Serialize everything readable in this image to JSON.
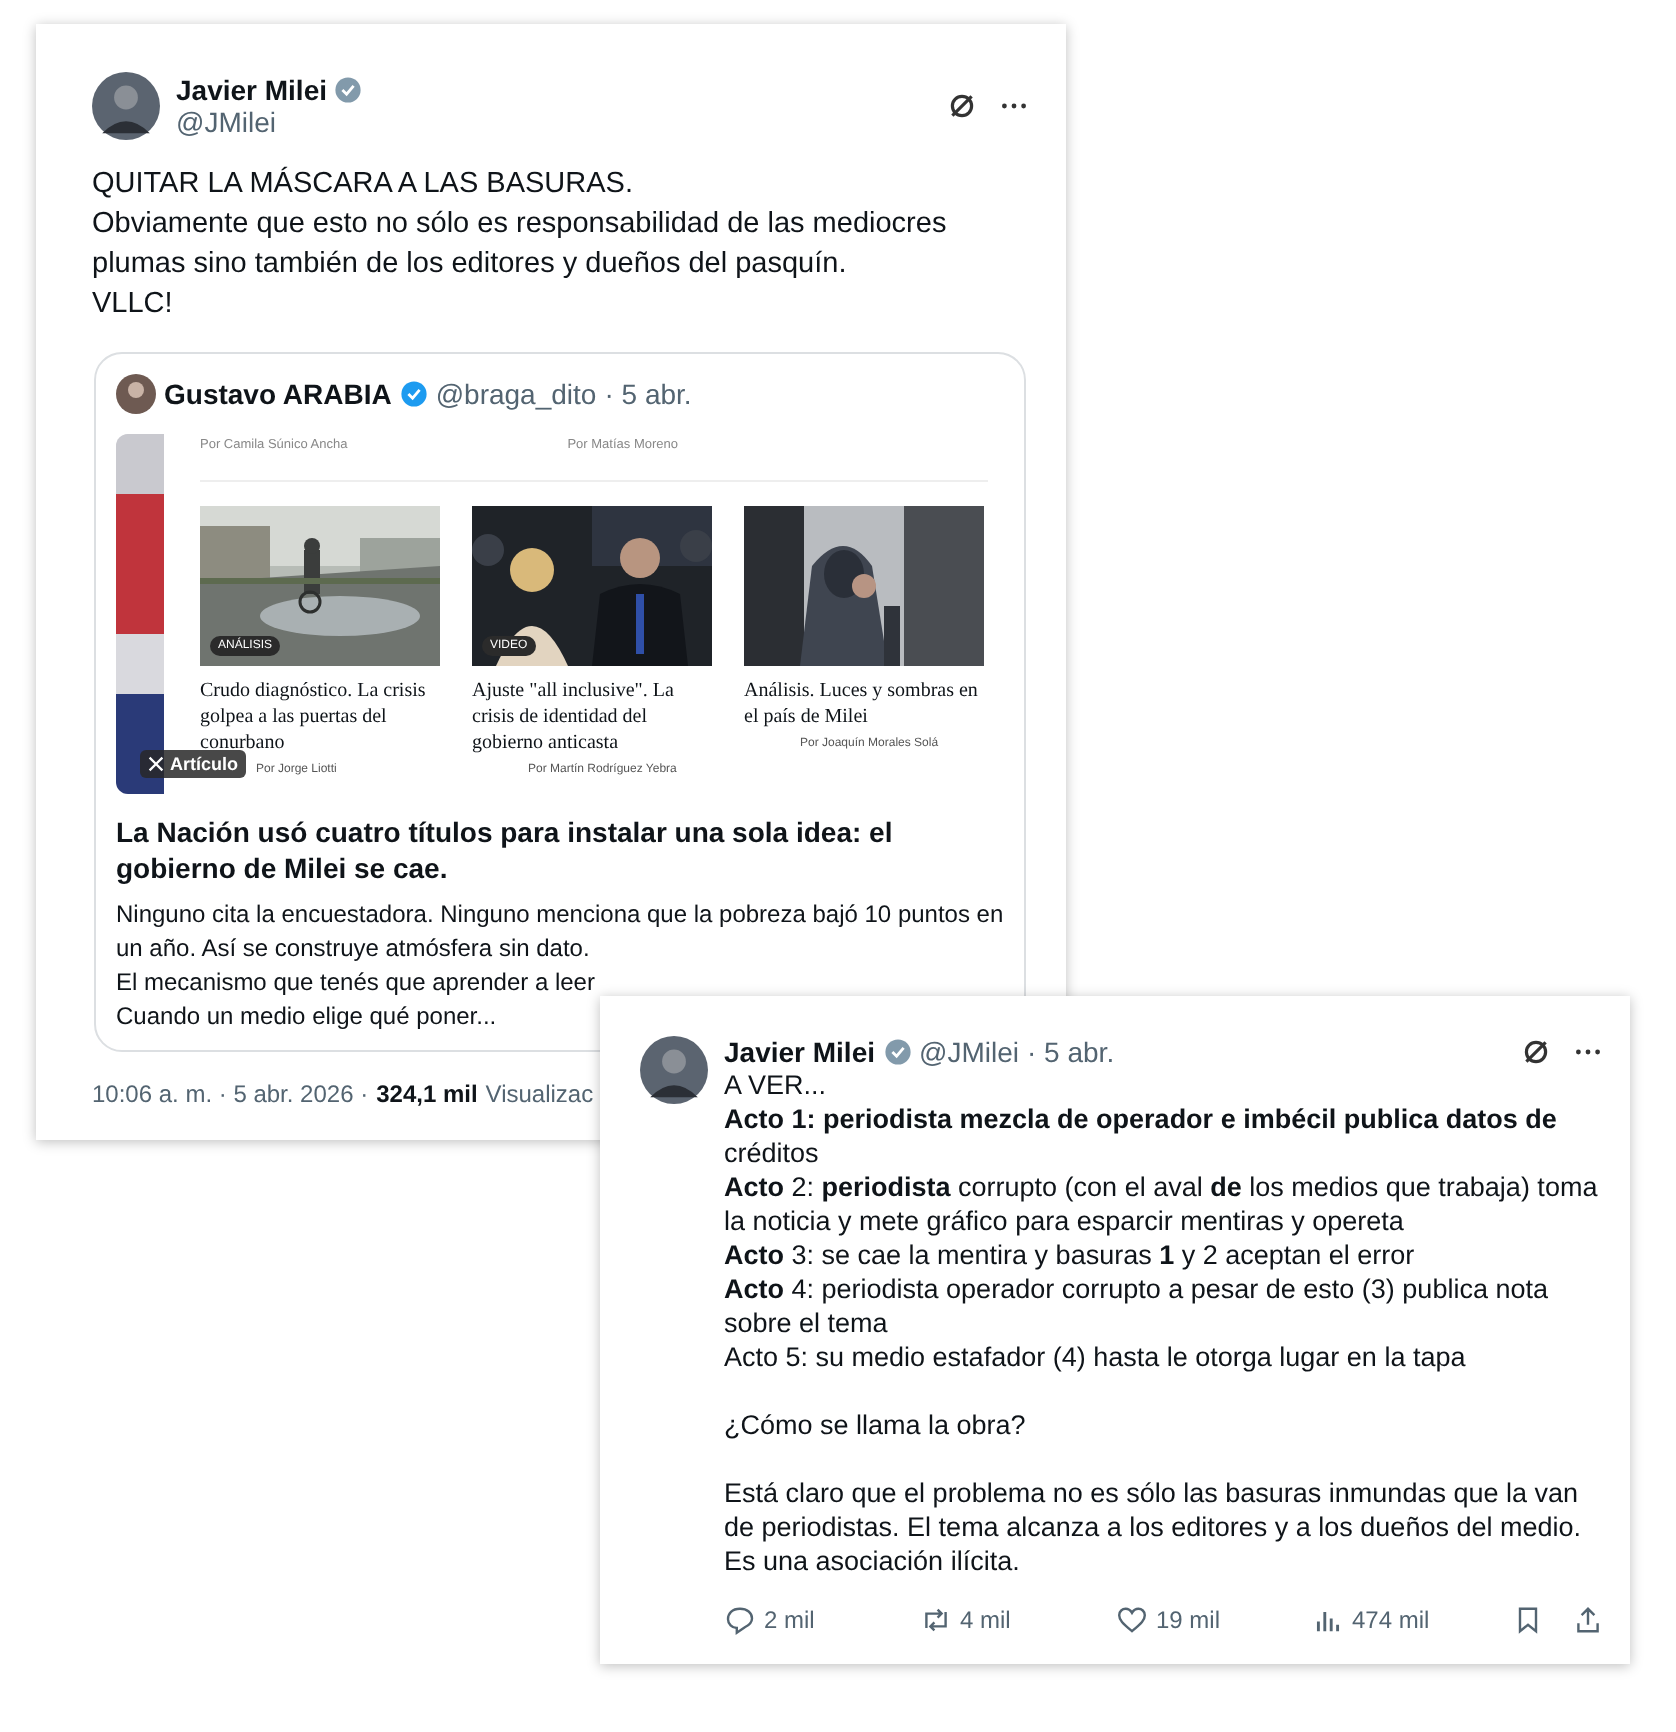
{
  "tweet": {
    "author": {
      "name": "Javier Milei",
      "handle": "@JMilei"
    },
    "text_lines": [
      "QUITAR LA MÁSCARA A LAS BASURAS.",
      "Obviamente que esto no sólo es responsabilidad de las mediocres plumas sino también de los editores y dueños del pasquín.",
      "VLLC!"
    ],
    "quote": {
      "author": {
        "name": "Gustavo ARABIA",
        "handle": "@braga_dito",
        "date": "· 5 abr."
      },
      "article": {
        "top_bylines": [
          "Por Camila Súnico Ancha",
          "Por Matías Moreno"
        ],
        "stories": [
          {
            "tag": "ANÁLISIS",
            "headline": "Crudo diagnóstico. La crisis golpea a las puertas del conurbano",
            "byline": "Por Jorge Liotti"
          },
          {
            "tag": "VIDEO",
            "headline": "Ajuste \"all inclusive\". La crisis de identidad del gobierno anticasta",
            "byline": "Por Martín Rodríguez Yebra"
          },
          {
            "headline": "Análisis. Luces y sombras en el país de Milei",
            "byline": "Por Joaquín Morales Solá"
          }
        ],
        "badge": "Artículo"
      },
      "title": "La Nación usó cuatro títulos para instalar una sola idea: el gobierno de Milei se cae.",
      "body_lines": [
        "Ninguno cita la encuestadora. Ninguno menciona que la pobreza bajó 10 puntos en un año. Así se construye atmósfera sin dato.",
        "El mecanismo que tenés que aprender a leer",
        "Cuando un medio elige qué poner..."
      ]
    },
    "footer": {
      "time": "10:06 a. m. · 5 abr. 2026 ·",
      "views": "324,1 mil",
      "views_label": "Visualizac"
    }
  },
  "reply_tweet": {
    "author": {
      "name": "Javier Milei",
      "handle": "@JMilei",
      "date": "· 5 abr."
    },
    "paragraphs": [
      [
        "A VER...",
        "**Acto 1: periodista mezcla de operador e imbécil publica datos de** créditos",
        "**Acto** 2: **periodista** corrupto (con el aval **de** los medios que trabaja) toma la noticia y mete gráfico para esparcir mentiras y opereta",
        "**Acto** 3: se cae la mentira y basuras **1** y 2 aceptan el error",
        "**Acto** 4: periodista operador corrupto a pesar de esto (3) publica nota sobre el tema",
        "Acto 5: su medio estafador (4) hasta le otorga lugar en la tapa"
      ],
      [
        "¿Cómo se llama la obra?"
      ],
      [
        "Está claro que el problema no es sólo las basuras inmundas que la van de periodistas. El tema alcanza a los editores y a los dueños del medio. Es una asociación ilícita."
      ]
    ],
    "actions": [
      {
        "kind": "reply",
        "count": "2 mil"
      },
      {
        "kind": "repost",
        "count": "4 mil"
      },
      {
        "kind": "like",
        "count": "19 mil"
      },
      {
        "kind": "views",
        "count": "474 mil"
      },
      {
        "kind": "bookmark"
      },
      {
        "kind": "share"
      }
    ]
  }
}
